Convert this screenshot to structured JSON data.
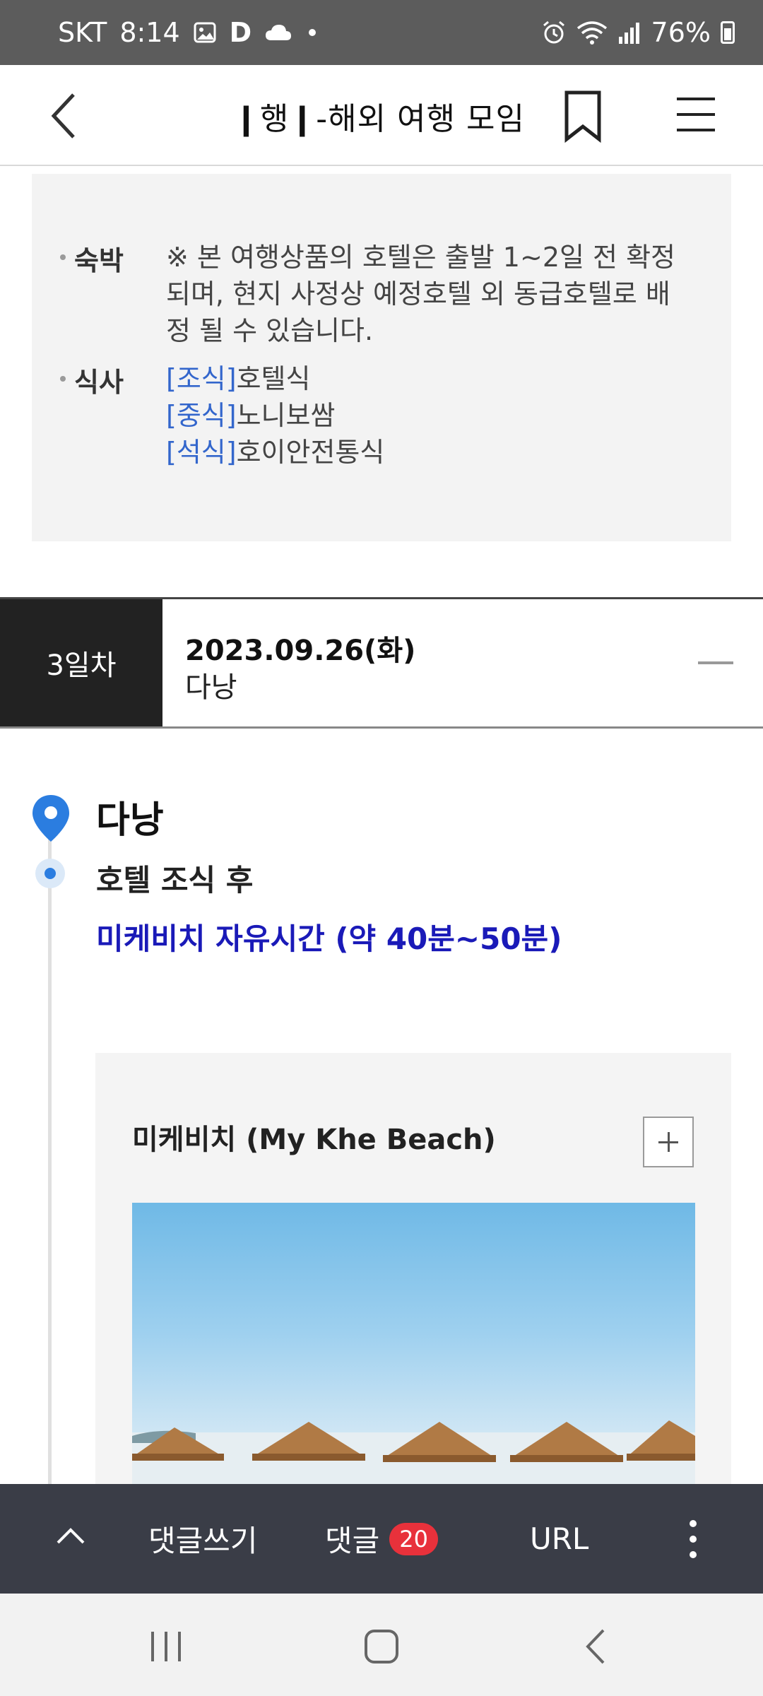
{
  "status_bar": {
    "carrier": "SKT",
    "time": "8:14",
    "battery": "76%",
    "icons": [
      "gallery-icon",
      "d-app-icon",
      "cloud-icon",
      "dot-icon",
      "alarm-icon",
      "wifi-icon",
      "signal-icon",
      "battery-icon"
    ]
  },
  "appbar": {
    "title": "❙행❙-해외 여행 모임",
    "icons": [
      "back-icon",
      "bookmark-icon",
      "menu-icon"
    ]
  },
  "info": {
    "lodging_label": "숙박",
    "lodging_text": "※ 본 여행상품의 호텔은 출발 1~2일 전 확정되며, 현지 사정상 예정호텔 외 동급호텔로 배정 될 수 있습니다.",
    "meal_label": "식사",
    "meals": [
      {
        "tag": "[조식]",
        "text": "호텔식"
      },
      {
        "tag": "[중식]",
        "text": "노니보쌈"
      },
      {
        "tag": "[석식]",
        "text": "호이안전통식"
      }
    ]
  },
  "day": {
    "badge": "3일차",
    "date": "2023.09.26(화)",
    "city": "다낭"
  },
  "timeline": {
    "city": "다낭",
    "step": "호텔 조식 후",
    "free_time": "미케비치 자유시간 (약 40분~50분)"
  },
  "card": {
    "title": "미케비치 (My Khe Beach)",
    "image": "beach-umbrellas-photo"
  },
  "actionbar": {
    "write_label": "댓글쓰기",
    "comments_label": "댓글",
    "comments_count": "20",
    "url_label": "URL"
  },
  "colors": {
    "status_bg": "#5c5c5c",
    "day_badge_bg": "#222222",
    "meal_tag": "#3366cc",
    "free_time_text": "#1a1ab8",
    "pin": "#2b7de0",
    "actionbar_bg": "#3a3d47",
    "badge_red": "#e8313b"
  }
}
